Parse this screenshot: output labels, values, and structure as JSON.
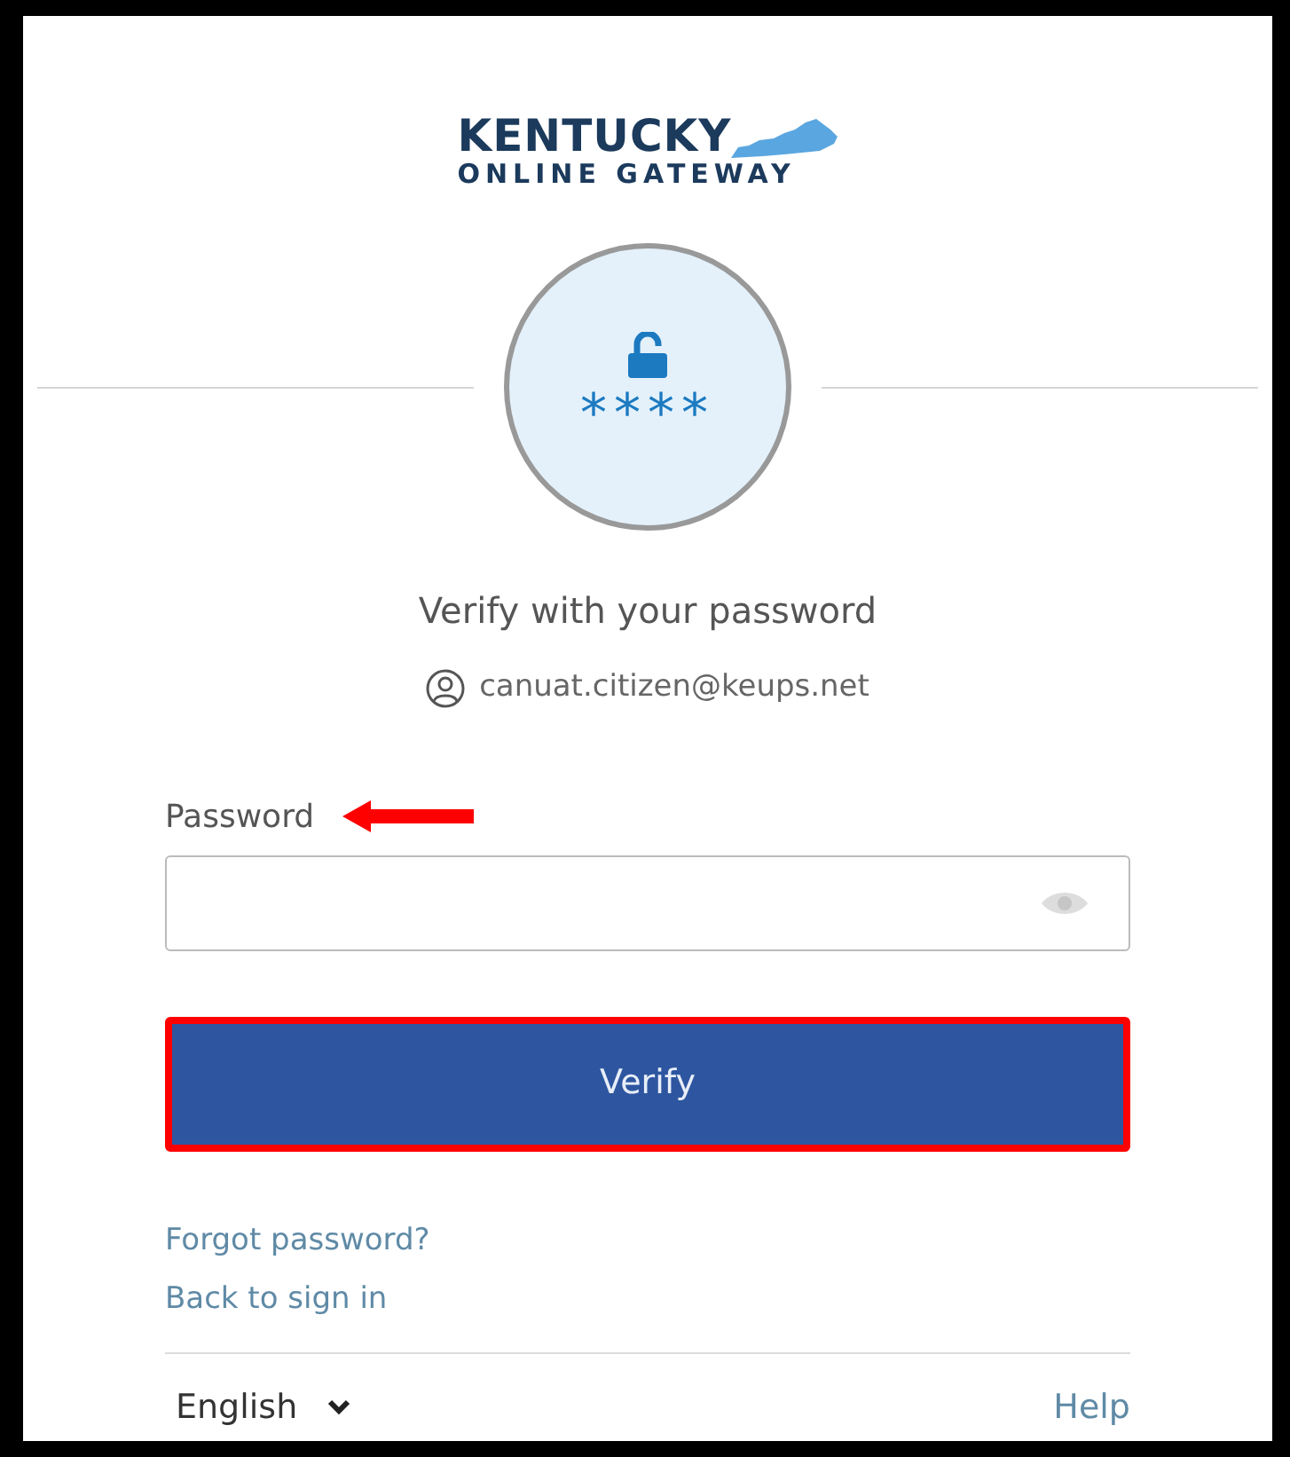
{
  "logo": {
    "line_1": "KENTUCKY",
    "line_2": "ONLINE GATEWAY"
  },
  "badge": {
    "text": "****"
  },
  "title": "Verify with your password",
  "identifier": "canuat.citizen@keups.net",
  "password": {
    "label": "Password",
    "callout_arrow": true
  },
  "verify_button": {
    "label": "Verify",
    "highlighted": true
  },
  "links": [
    "Forgot password?",
    "Back to sign in"
  ],
  "footer": {
    "language": "English",
    "help": "Help"
  }
}
